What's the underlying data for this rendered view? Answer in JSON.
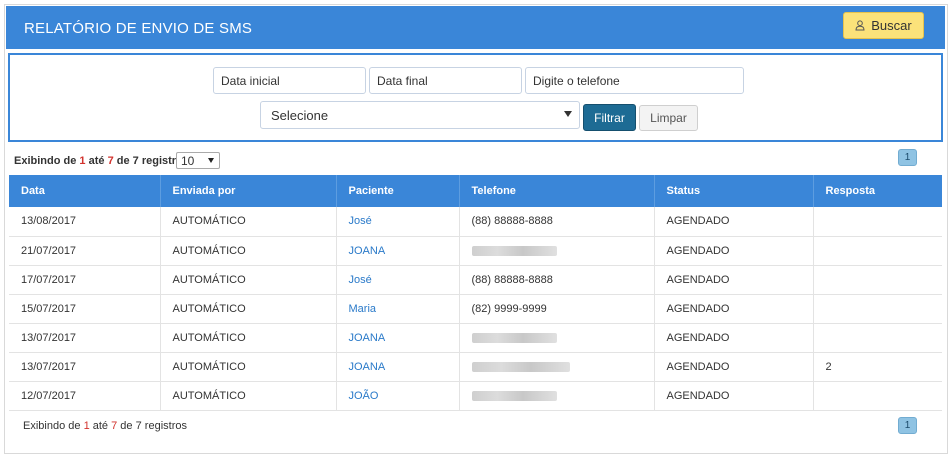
{
  "header": {
    "title": "RELATÓRIO DE ENVIO DE SMS",
    "buscar_label": "Buscar",
    "buscar_icon": "user-icon"
  },
  "filters": {
    "data_inicial_placeholder": "Data inicial",
    "data_final_placeholder": "Data final",
    "telefone_placeholder": "Digite o telefone",
    "select_value": "Selecione",
    "filtrar_label": "Filtrar",
    "limpar_label": "Limpar"
  },
  "info_top": {
    "prefix": "Exibindo de",
    "from": "1",
    "mid": "até",
    "to": "7",
    "of": "de",
    "total": "7",
    "suffix": "registros",
    "page_size": "10"
  },
  "info_bottom": {
    "prefix": "Exibindo de",
    "from": "1",
    "mid": "até",
    "to": "7",
    "of": "de",
    "total": "7",
    "suffix": "registros"
  },
  "pagination": {
    "current_page": "1"
  },
  "table": {
    "headers": [
      "Data",
      "Enviada por",
      "Paciente",
      "Telefone",
      "Status",
      "Resposta"
    ],
    "rows": [
      {
        "data": "13/08/2017",
        "enviada_por": "AUTOMÁTICO",
        "paciente": "José",
        "telefone": "(88) 88888-8888",
        "status": "AGENDADO",
        "resposta": ""
      },
      {
        "data": "21/07/2017",
        "enviada_por": "AUTOMÁTICO",
        "paciente": "JOANA",
        "telefone": "",
        "status": "AGENDADO",
        "resposta": ""
      },
      {
        "data": "17/07/2017",
        "enviada_por": "AUTOMÁTICO",
        "paciente": "José",
        "telefone": "(88) 88888-8888",
        "status": "AGENDADO",
        "resposta": ""
      },
      {
        "data": "15/07/2017",
        "enviada_por": "AUTOMÁTICO",
        "paciente": "Maria",
        "telefone": "(82) 9999-9999",
        "status": "AGENDADO",
        "resposta": ""
      },
      {
        "data": "13/07/2017",
        "enviada_por": "AUTOMÁTICO",
        "paciente": "JOANA",
        "telefone": "",
        "status": "AGENDADO",
        "resposta": ""
      },
      {
        "data": "13/07/2017",
        "enviada_por": "AUTOMÁTICO",
        "paciente": "JOANA",
        "telefone": "",
        "status": "AGENDADO",
        "resposta": "2"
      },
      {
        "data": "12/07/2017",
        "enviada_por": "AUTOMÁTICO",
        "paciente": "JOÃO",
        "telefone": "",
        "status": "AGENDADO",
        "resposta": ""
      }
    ]
  },
  "colors": {
    "header_bg": "#3a86d8",
    "buscar_bg": "#fbe27a",
    "filtrar_bg": "#1d6b94",
    "link": "#2a7ac9",
    "highlight_number": "#d2322d"
  }
}
